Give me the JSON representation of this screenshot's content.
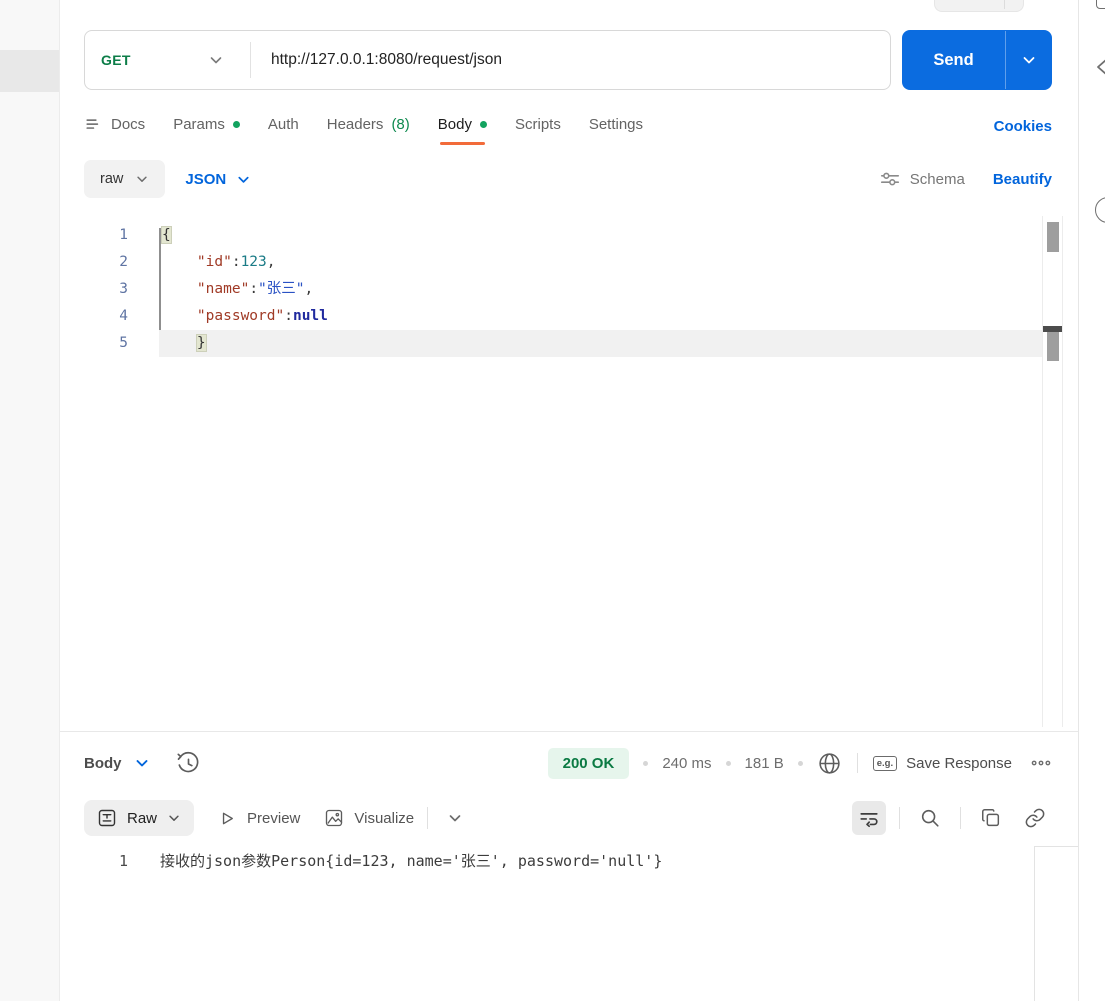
{
  "colors": {
    "accent_blue": "#0265dc",
    "send_blue": "#0b6ce0",
    "method_green": "#0c7d48",
    "dot_green": "#12a35f",
    "tab_underline_orange": "#f26b3a",
    "status_green_text": "#0b7a43",
    "status_green_bg": "#e6f5ec"
  },
  "request": {
    "method": "GET",
    "url": "http://127.0.0.1:8080/request/json",
    "send_label": "Send",
    "cookies_label": "Cookies",
    "tabs": [
      {
        "id": "docs",
        "label": "Docs",
        "icon": "docs-lines-icon"
      },
      {
        "id": "params",
        "label": "Params",
        "dot": true
      },
      {
        "id": "auth",
        "label": "Auth"
      },
      {
        "id": "headers",
        "label": "Headers",
        "count": "(8)"
      },
      {
        "id": "body",
        "label": "Body",
        "dot": true,
        "active": true
      },
      {
        "id": "scripts",
        "label": "Scripts"
      },
      {
        "id": "settings",
        "label": "Settings"
      }
    ],
    "body_mode": "raw",
    "body_format": "JSON",
    "schema_label": "Schema",
    "beautify_label": "Beautify",
    "code_lines": [
      {
        "num": "1",
        "tokens": [
          {
            "t": "{",
            "c": "brace",
            "match": true
          }
        ]
      },
      {
        "num": "2",
        "tokens": [
          {
            "t": "    ",
            "c": "punct"
          },
          {
            "t": "\"id\"",
            "c": "key"
          },
          {
            "t": ":",
            "c": "punct"
          },
          {
            "t": "123",
            "c": "num"
          },
          {
            "t": ",",
            "c": "punct"
          }
        ]
      },
      {
        "num": "3",
        "tokens": [
          {
            "t": "    ",
            "c": "punct"
          },
          {
            "t": "\"name\"",
            "c": "key"
          },
          {
            "t": ":",
            "c": "punct"
          },
          {
            "t": "\"张三\"",
            "c": "str"
          },
          {
            "t": ",",
            "c": "punct"
          }
        ]
      },
      {
        "num": "4",
        "tokens": [
          {
            "t": "    ",
            "c": "punct"
          },
          {
            "t": "\"password\"",
            "c": "key"
          },
          {
            "t": ":",
            "c": "punct"
          },
          {
            "t": "null",
            "c": "atom"
          }
        ]
      },
      {
        "num": "5",
        "active": true,
        "tokens": [
          {
            "t": "    ",
            "c": "punct"
          },
          {
            "t": "}",
            "c": "brace",
            "match": true
          }
        ]
      }
    ]
  },
  "response": {
    "pane_label": "Body",
    "status": "200 OK",
    "time": "240 ms",
    "size": "181 B",
    "eg_label": "e.g.",
    "save_label": "Save Response",
    "views": {
      "raw": "Raw",
      "preview": "Preview",
      "visualize": "Visualize"
    },
    "lines": [
      {
        "num": "1",
        "text": "接收的json参数Person{id=123, name='张三', password='null'}"
      }
    ]
  }
}
